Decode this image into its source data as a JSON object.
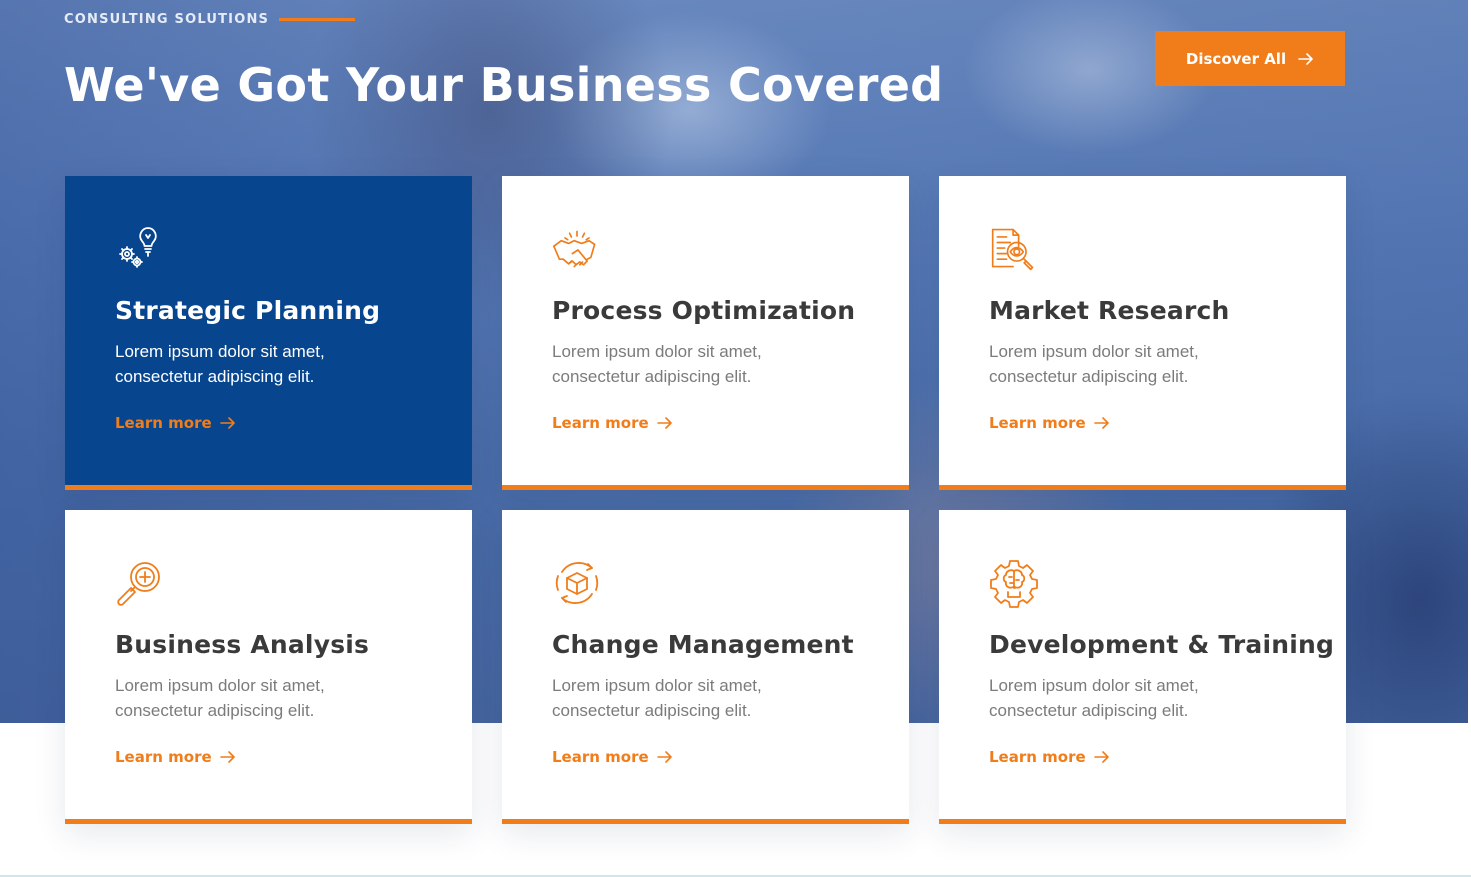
{
  "header": {
    "eyebrow": "CONSULTING SOLUTIONS",
    "title": "We've Got Your Business Covered",
    "cta_label": "Discover All"
  },
  "colors": {
    "accent": "#f07d1a",
    "featured_card": "#07468f",
    "heading_text": "#3a3a3a",
    "body_text": "#7b7b7b"
  },
  "services": [
    {
      "icon": "gears-lightbulb-icon",
      "title": "Strategic Planning",
      "description": "Lorem ipsum dolor sit amet, consectetur adipiscing elit.",
      "link_label": "Learn more",
      "featured": true
    },
    {
      "icon": "handshake-icon",
      "title": "Process Optimization",
      "description": "Lorem ipsum dolor sit amet, consectetur adipiscing elit.",
      "link_label": "Learn more",
      "featured": false
    },
    {
      "icon": "document-magnifier-icon",
      "title": "Market Research",
      "description": "Lorem ipsum dolor sit amet, consectetur adipiscing elit.",
      "link_label": "Learn more",
      "featured": false
    },
    {
      "icon": "magnifier-plus-icon",
      "title": "Business Analysis",
      "description": "Lorem ipsum dolor sit amet, consectetur adipiscing elit.",
      "link_label": "Learn more",
      "featured": false
    },
    {
      "icon": "cube-cycle-icon",
      "title": "Change Management",
      "description": "Lorem ipsum dolor sit amet, consectetur adipiscing elit.",
      "link_label": "Learn more",
      "featured": false
    },
    {
      "icon": "gear-brain-icon",
      "title": "Development & Training",
      "description": "Lorem ipsum dolor sit amet, consectetur adipiscing elit.",
      "link_label": "Learn more",
      "featured": false
    }
  ]
}
